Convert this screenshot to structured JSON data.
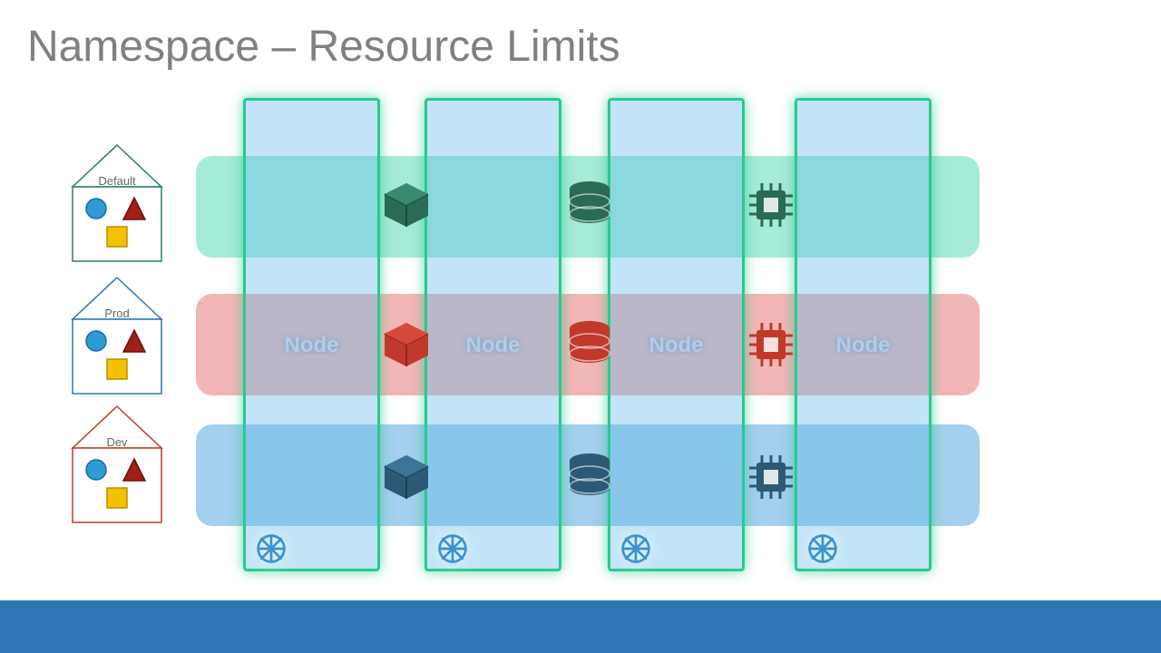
{
  "title": "Namespace – Resource Limits",
  "namespaces": [
    {
      "key": "default",
      "label": "Default",
      "border": "#2e7d5c",
      "barColor": "#5dd9b8",
      "iconColor": "#2a6b55"
    },
    {
      "key": "prod",
      "label": "Prod",
      "border": "#2e75b6",
      "barColor": "#e77a7a",
      "iconColor": "#c0392b"
    },
    {
      "key": "dev",
      "label": "Dev",
      "border": "#c0392b",
      "barColor": "#5aa8e0",
      "iconColor": "#2c5a76"
    }
  ],
  "nodes": {
    "count": 4,
    "label": "Node"
  },
  "resourceIcons": [
    "box",
    "database",
    "cpu"
  ]
}
